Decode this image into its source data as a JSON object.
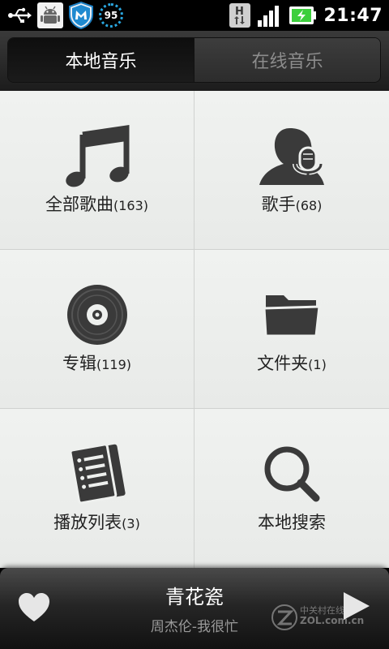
{
  "status_bar": {
    "icons": [
      "usb-icon",
      "android-debug-icon",
      "security-shield-icon",
      "badge-icon",
      "h-data-icon",
      "signal-icon",
      "battery-charging-icon"
    ],
    "badge_value": "95",
    "network_type": "H",
    "signal_bars": 4,
    "clock": "21:47"
  },
  "tabs": [
    {
      "label": "本地音乐",
      "active": true
    },
    {
      "label": "在线音乐",
      "active": false
    }
  ],
  "grid": [
    {
      "icon": "music-note-icon",
      "label": "全部歌曲",
      "count": "(163)"
    },
    {
      "icon": "singer-icon",
      "label": "歌手",
      "count": "(68)"
    },
    {
      "icon": "album-disc-icon",
      "label": "专辑",
      "count": "(119)"
    },
    {
      "icon": "folder-icon",
      "label": "文件夹",
      "count": "(1)"
    },
    {
      "icon": "playlist-icon",
      "label": "播放列表",
      "count": "(3)"
    },
    {
      "icon": "search-icon",
      "label": "本地搜索",
      "count": ""
    }
  ],
  "now_playing": {
    "title": "青花瓷",
    "artist": "周杰伦-我很忙"
  },
  "watermark": {
    "line1": "中关村在线",
    "line2": "ZOL.com.cn"
  },
  "colors": {
    "background": "#000000",
    "grid_cell": "#eef0ee",
    "accent_blue": "#2aa7e0",
    "battery_green": "#3ccf3c"
  }
}
